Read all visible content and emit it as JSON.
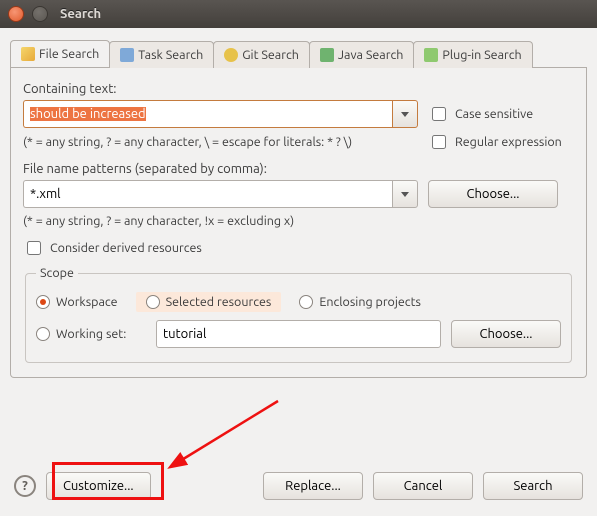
{
  "window": {
    "title": "Search"
  },
  "tabs": {
    "file": {
      "label": "File Search"
    },
    "task": {
      "label": "Task Search"
    },
    "git": {
      "label": "Git Search"
    },
    "java": {
      "label": "Java Search"
    },
    "plugin": {
      "label": "Plug-in Search"
    }
  },
  "containing": {
    "label": "Containing text:",
    "value": "should be increased",
    "hint": "(* = any string, ? = any character, \\ = escape for literals: * ? \\)"
  },
  "case_sensitive_label": "Case sensitive",
  "regex_label": "Regular expression",
  "filename": {
    "label": "File name patterns (separated by comma):",
    "value": "*.xml",
    "hint": "(* = any string, ? = any character, !x = excluding x)",
    "choose": "Choose..."
  },
  "derived_label": "Consider derived resources",
  "scope": {
    "legend": "Scope",
    "workspace": "Workspace",
    "selected": "Selected resources",
    "enclosing": "Enclosing projects",
    "workingset": "Working set:",
    "workingset_value": "tutorial",
    "choose": "Choose..."
  },
  "footer": {
    "customize": "Customize...",
    "replace": "Replace...",
    "cancel": "Cancel",
    "search": "Search"
  }
}
